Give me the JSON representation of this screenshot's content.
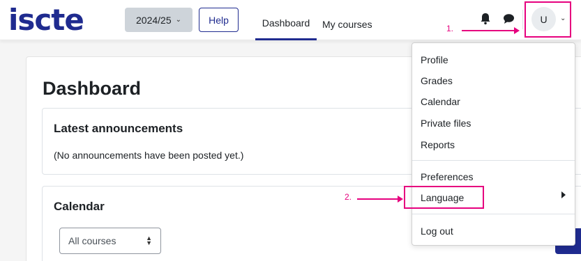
{
  "brand": {
    "logo_text": "iscte",
    "color": "#1f2b8f"
  },
  "navbar": {
    "year_label": "2024/25",
    "help_label": "Help",
    "links": [
      {
        "label": "Dashboard"
      },
      {
        "label": "My courses"
      }
    ],
    "user_initial": "U"
  },
  "main": {
    "title": "Dashboard",
    "announcements": {
      "title": "Latest announcements",
      "text": "(No announcements have been posted yet.)"
    },
    "calendar": {
      "title": "Calendar",
      "courses_select": "All courses"
    }
  },
  "user_menu": {
    "items": [
      {
        "label": "Profile"
      },
      {
        "label": "Grades"
      },
      {
        "label": "Calendar"
      },
      {
        "label": "Private files"
      },
      {
        "label": "Reports"
      },
      {
        "label": "Preferences"
      },
      {
        "label": "Language"
      },
      {
        "label": "Log out"
      }
    ]
  },
  "annotations": {
    "step1": "1.",
    "step2": "2.",
    "color": "#e6007e"
  }
}
